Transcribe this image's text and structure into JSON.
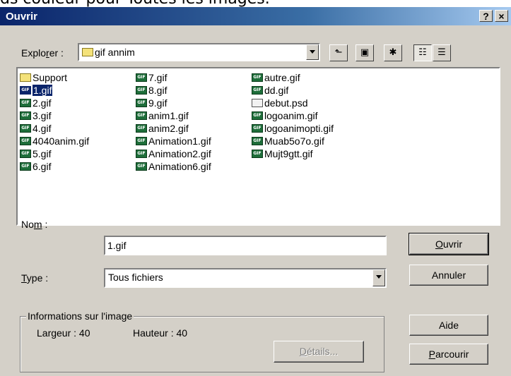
{
  "caption_above": "ds couleur pour Toutes les images.",
  "window": {
    "title": "Ouvrir",
    "help_button": "?",
    "close_button": "×"
  },
  "explorer": {
    "label_pre": "Explo",
    "label_mnemonic": "r",
    "label_post": "er :",
    "location": "gif annim"
  },
  "toolbar": {
    "icons": [
      "up-folder-icon",
      "desktop-icon",
      "new-folder-icon",
      "list-view-icon",
      "details-view-icon"
    ]
  },
  "files": {
    "columns": [
      [
        {
          "name": "Support",
          "icon": "folder-icon"
        },
        {
          "name": "1.gif",
          "icon": "gif-icon",
          "selected": true
        },
        {
          "name": "2.gif",
          "icon": "gif-icon"
        },
        {
          "name": "3.gif",
          "icon": "gif-icon"
        },
        {
          "name": "4.gif",
          "icon": "gif-icon"
        },
        {
          "name": "4040anim.gif",
          "icon": "gif-icon"
        },
        {
          "name": "5.gif",
          "icon": "gif-icon"
        },
        {
          "name": "6.gif",
          "icon": "gif-icon"
        }
      ],
      [
        {
          "name": "7.gif",
          "icon": "gif-icon"
        },
        {
          "name": "8.gif",
          "icon": "gif-icon"
        },
        {
          "name": "9.gif",
          "icon": "gif-icon"
        },
        {
          "name": "anim1.gif",
          "icon": "gif-icon"
        },
        {
          "name": "anim2.gif",
          "icon": "gif-icon"
        },
        {
          "name": "Animation1.gif",
          "icon": "gif-icon"
        },
        {
          "name": "Animation2.gif",
          "icon": "gif-icon"
        },
        {
          "name": "Animation6.gif",
          "icon": "gif-icon"
        }
      ],
      [
        {
          "name": "autre.gif",
          "icon": "gif-icon"
        },
        {
          "name": "dd.gif",
          "icon": "gif-icon"
        },
        {
          "name": "debut.psd",
          "icon": "psd-file-icon"
        },
        {
          "name": "logoanim.gif",
          "icon": "gif-icon"
        },
        {
          "name": "logoanimopti.gif",
          "icon": "gif-icon"
        },
        {
          "name": "Muab5o7o.gif",
          "icon": "gif-icon"
        },
        {
          "name": "Mujt9gtt.gif",
          "icon": "gif-icon"
        }
      ]
    ]
  },
  "name_field": {
    "label_pre": "No",
    "label_mnemonic": "m",
    "label_post": " :",
    "value": "1.gif"
  },
  "type_field": {
    "label_mnemonic": "T",
    "label_post": "ype :",
    "value": "Tous fichiers"
  },
  "buttons": {
    "open_mnemonic": "O",
    "open_rest": "uvrir",
    "cancel": "Annuler",
    "help": "Aide",
    "browse_mnemonic": "P",
    "browse_rest": "arcourir",
    "details_mnemonic": "D",
    "details_rest": "étails..."
  },
  "image_info": {
    "group_title": "Informations sur l'image",
    "width_label": "Largeur : 40",
    "height_label": "Hauteur : 40"
  }
}
